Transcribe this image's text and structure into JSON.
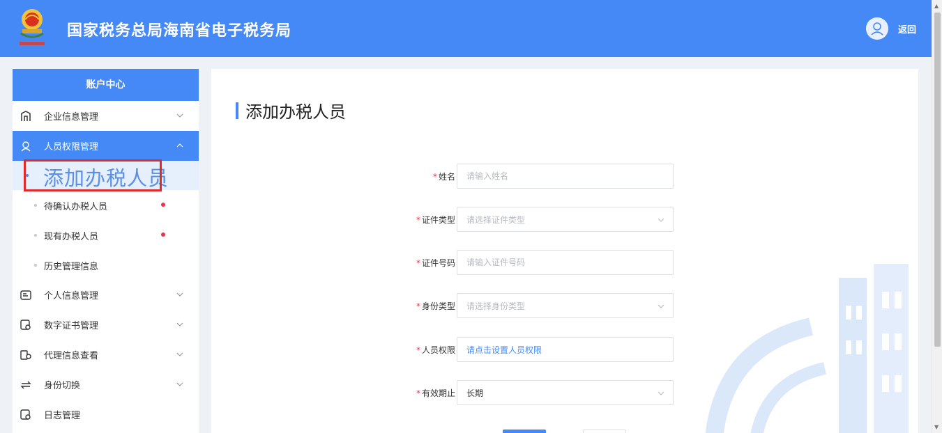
{
  "header": {
    "title": "国家税务总局海南省电子税务局",
    "back_label": "返回"
  },
  "sidebar": {
    "heading": "账户中心",
    "items": [
      {
        "label": "企业信息管理",
        "icon": "building-icon",
        "expanded": false
      },
      {
        "label": "人员权限管理",
        "icon": "user-permission-icon",
        "expanded": true,
        "active": true
      },
      {
        "label": "个人信息管理",
        "icon": "id-card-icon",
        "expanded": false
      },
      {
        "label": "数字证书管理",
        "icon": "certificate-icon",
        "expanded": false
      },
      {
        "label": "代理信息查看",
        "icon": "agent-icon",
        "expanded": false
      },
      {
        "label": "身份切换",
        "icon": "switch-identity-icon",
        "expanded": false
      },
      {
        "label": "日志管理",
        "icon": "log-icon",
        "expanded": false
      }
    ],
    "sub_items": [
      {
        "label": "添加办税人员",
        "current": true,
        "badge": false
      },
      {
        "label": "待确认办税人员",
        "current": false,
        "badge": true
      },
      {
        "label": "现有办税人员",
        "current": false,
        "badge": true
      },
      {
        "label": "历史管理信息",
        "current": false,
        "badge": false
      }
    ]
  },
  "main": {
    "title": "添加办税人员",
    "form": {
      "name": {
        "label": "姓名",
        "placeholder": "请输入姓名",
        "required": true
      },
      "id_type": {
        "label": "证件类型",
        "placeholder": "请选择证件类型",
        "required": true
      },
      "id_number": {
        "label": "证件号码",
        "placeholder": "请输入证件号码",
        "required": true
      },
      "identity_type": {
        "label": "身份类型",
        "placeholder": "请选择身份类型",
        "required": true
      },
      "permission": {
        "label": "人员权限",
        "value": "请点击设置人员权限",
        "required": true
      },
      "valid_until": {
        "label": "有效期止",
        "value": "长期",
        "required": true
      }
    },
    "required_mark": "*"
  },
  "colors": {
    "brand_blue": "#4489f5",
    "required_red": "#e8374a",
    "highlight_red": "#e02a2a"
  }
}
